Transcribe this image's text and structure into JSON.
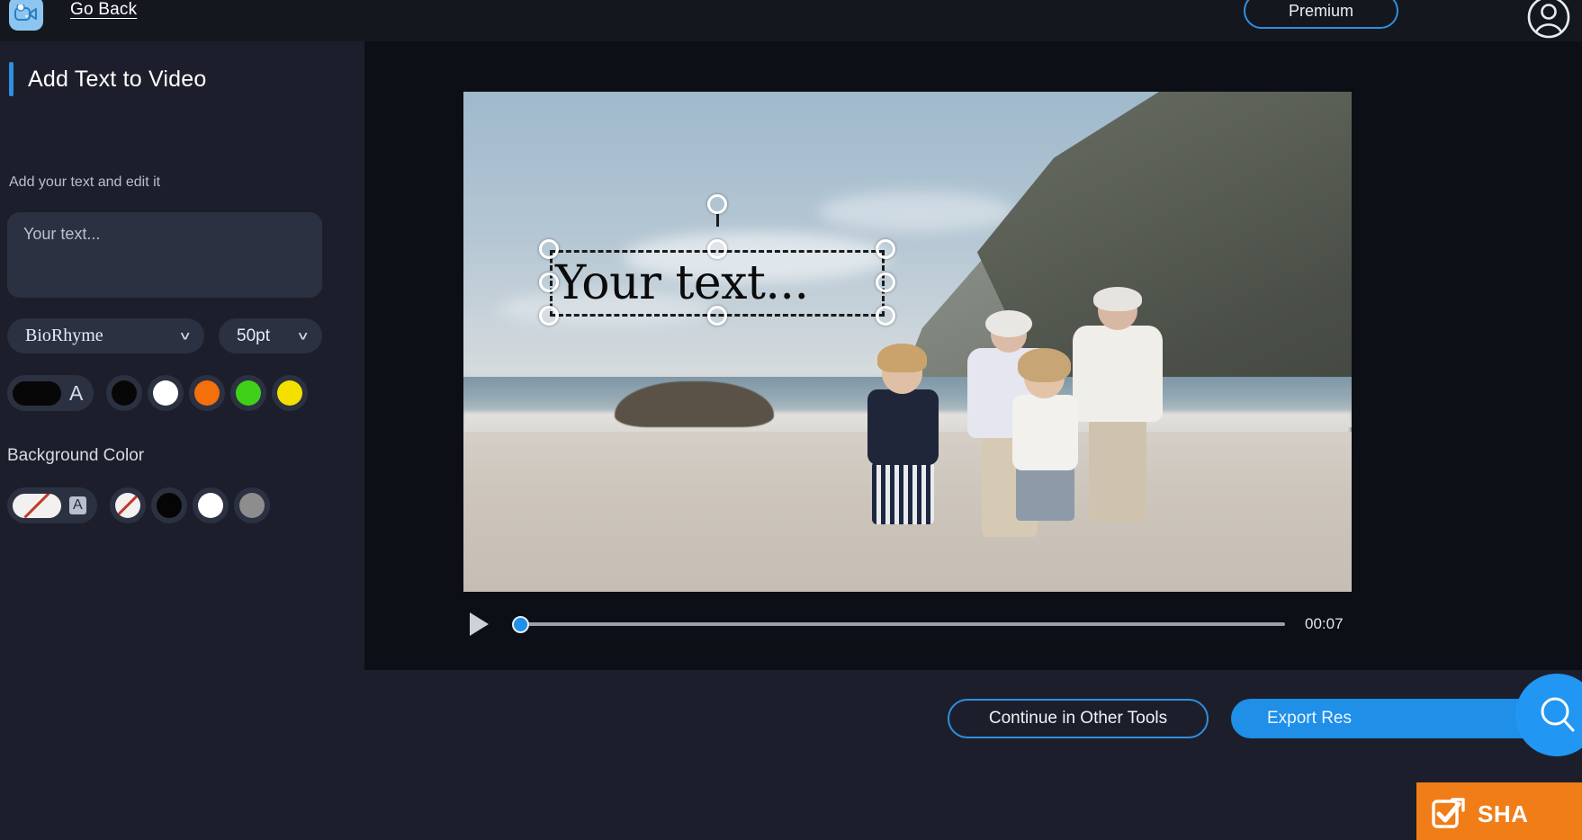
{
  "topbar": {
    "logo_icon": "video-camera-icon",
    "go_back_label": "Go Back",
    "premium_label": "Premium",
    "avatar_icon": "user-avatar-icon"
  },
  "sidebar": {
    "panel_title": "Add Text to Video",
    "helper_text": "Add your text and edit it",
    "text_input": {
      "value": "",
      "placeholder": "Your text..."
    },
    "font_select": {
      "value": "BioRhyme",
      "chevron": "∨"
    },
    "size_select": {
      "value": "50pt",
      "chevron": "∨"
    },
    "text_color": {
      "selected_label": "A",
      "selected_hex": "#070707",
      "swatches": [
        "#070707",
        "#ffffff",
        "#f4700c",
        "#3fd119",
        "#f3e000"
      ]
    },
    "background_color": {
      "section_label": "Background Color",
      "selected_label": "A",
      "selected_hex": "none",
      "swatches": [
        "none",
        "#050505",
        "#ffffff",
        "#8d8d8d"
      ]
    }
  },
  "video": {
    "overlay_text": "Your text...",
    "overlay_font": "BioRhyme serif",
    "overlay_color": "#0b0b0b"
  },
  "player": {
    "play_icon": "play-icon",
    "progress_percent": 0,
    "timecode": "00:07"
  },
  "bottombar": {
    "continue_label": "Continue in Other Tools",
    "export_label": "Export Res",
    "help_icon": "search-help-icon",
    "share_badge": {
      "icon": "share-check-icon",
      "label": "SHA",
      "color": "#f07d18"
    }
  },
  "colors": {
    "accent_blue": "#2f8fe0",
    "sidebar_bg": "#1c1f2b",
    "main_bg": "#0d0f16",
    "topbar_bg": "#15171f"
  }
}
